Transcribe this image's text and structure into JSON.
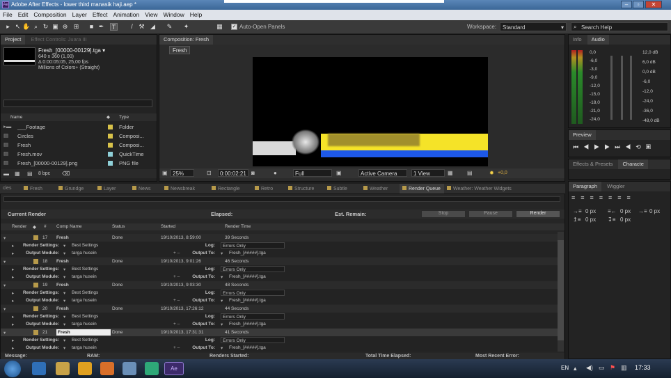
{
  "window": {
    "title": "Adobe After Effects - lower third manasik haji.aep *",
    "app_icon": "Ae",
    "controls": [
      "minimize",
      "maximize",
      "close"
    ]
  },
  "menu": [
    "File",
    "Edit",
    "Composition",
    "Layer",
    "Effect",
    "Animation",
    "View",
    "Window",
    "Help"
  ],
  "toolbar": {
    "auto_open": "Auto-Open Panels",
    "workspace_label": "Workspace:",
    "workspace_value": "Standard",
    "search": "Search Help"
  },
  "project": {
    "tab": "Project",
    "effect_tab": "Effect Controls: Juara III",
    "item_name": "Fresh_[00000-00129].tga ▾",
    "item_size": "640 x 360 (1,00)",
    "item_dur": "Δ 0:00:05:05, 25,00 fps",
    "item_colors": "Millions of Colors+ (Straight)",
    "col_name": "Name",
    "col_type": "Type",
    "bpc": "8 bpc",
    "items": [
      {
        "name": "___Footage",
        "type": "Folder",
        "color": "#d8c24a"
      },
      {
        "name": "Circles",
        "type": "Composi...",
        "color": "#d8c24a"
      },
      {
        "name": "Fresh",
        "type": "Composi...",
        "color": "#d8c24a"
      },
      {
        "name": "Fresh.mov",
        "type": "QuickTime",
        "color": "#8fd0d8"
      },
      {
        "name": "Fresh_[00000-00129].png",
        "type": "PNG file",
        "color": "#8fd0d8"
      }
    ]
  },
  "composition": {
    "tab": "Composition: Fresh",
    "subtab": "Fresh",
    "zoom": "25%",
    "timecode": "0:00:02:21",
    "res": "Full",
    "camera": "Active Camera",
    "views": "1 View",
    "exposure": "+0,0"
  },
  "info": {
    "tab_info": "Info",
    "tab_audio": "Audio",
    "left": [
      "0,0",
      "-6,0",
      "-3,0",
      "-9,0",
      "-12,0",
      "-15,0",
      "-18,0",
      "-21,0",
      "-24,0"
    ],
    "right": [
      "12,0 dB",
      "6,0 dB",
      "0,0 dB",
      "-6,0",
      "-12,0",
      "-24,0",
      "-36,0",
      "-48,0 dB"
    ]
  },
  "preview": {
    "tab": "Preview"
  },
  "effects": {
    "tab1": "Effects & Presets",
    "tab2": "Characte"
  },
  "paragraph": {
    "tab1": "Paragraph",
    "tab2": "Wiggler",
    "px": [
      "0 px",
      "0 px",
      "0 px",
      "0 px",
      "0 px"
    ]
  },
  "timeline_tabs": [
    "cles",
    "Fresh",
    "Grundge",
    "Layer",
    "News",
    "Newsbreak",
    "Rectangle",
    "Retro",
    "Structure",
    "Subtle",
    "Weather",
    "Render Queue",
    "Weather: Weather Widgets"
  ],
  "render": {
    "current": "Current Render",
    "elapsed": "Elapsed:",
    "remain": "Est. Remain:",
    "stop": "Stop",
    "pause": "Pause",
    "render": "Render",
    "cols": [
      "Render",
      "#",
      "Comp Name",
      "Status",
      "Started",
      "Render Time"
    ],
    "settings_lbl": "Render Settings:",
    "output_lbl": "Output Module:",
    "log_lbl": "Log:",
    "outto_lbl": "Output To:",
    "best": "Best Settings",
    "targa": "targa husein",
    "errors": "Errors Only",
    "file": "Fresh_[#####].tga",
    "jobs": [
      {
        "n": "17",
        "comp": "Fresh",
        "status": "Done",
        "started": "19/10/2013, 8:59:00",
        "time": "39 Seconds"
      },
      {
        "n": "18",
        "comp": "Fresh",
        "status": "Done",
        "started": "19/10/2013, 9:01:26",
        "time": "46 Seconds"
      },
      {
        "n": "19",
        "comp": "Fresh",
        "status": "Done",
        "started": "19/10/2013, 9:03:30",
        "time": "48 Seconds"
      },
      {
        "n": "20",
        "comp": "Fresh",
        "status": "Done",
        "started": "19/10/2013, 17:26:12",
        "time": "44 Seconds"
      },
      {
        "n": "21",
        "comp": "Fresh",
        "status": "Done",
        "started": "19/10/2013, 17:31:31",
        "time": "41 Seconds"
      }
    ],
    "status_bar": {
      "message": "Message:",
      "ram": "RAM:",
      "started": "Renders Started:",
      "total": "Total Time Elapsed:",
      "recent": "Most Recent Error:"
    }
  },
  "taskbar": {
    "lang": "EN",
    "time": "17:33"
  }
}
